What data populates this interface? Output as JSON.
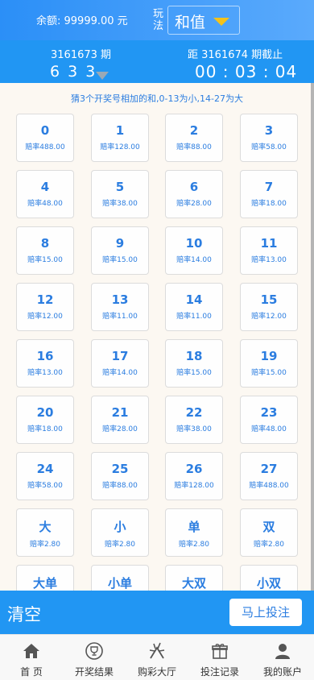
{
  "header": {
    "balance": "余额: 99999.00 元",
    "play_label": "玩法",
    "play_value": "和值"
  },
  "issue": {
    "current": "3161673 期",
    "result": "6 3 3",
    "next": "距 3161674 期截止",
    "countdown": "00 : 03 : 04"
  },
  "rule": "猜3个开奖号相加的和,0-13为小,14-27为大",
  "bets": [
    {
      "label": "0",
      "odds": "赔率488.00"
    },
    {
      "label": "1",
      "odds": "赔率128.00"
    },
    {
      "label": "2",
      "odds": "赔率88.00"
    },
    {
      "label": "3",
      "odds": "赔率58.00"
    },
    {
      "label": "4",
      "odds": "赔率48.00"
    },
    {
      "label": "5",
      "odds": "赔率38.00"
    },
    {
      "label": "6",
      "odds": "赔率28.00"
    },
    {
      "label": "7",
      "odds": "赔率18.00"
    },
    {
      "label": "8",
      "odds": "赔率15.00"
    },
    {
      "label": "9",
      "odds": "赔率15.00"
    },
    {
      "label": "10",
      "odds": "赔率14.00"
    },
    {
      "label": "11",
      "odds": "赔率13.00"
    },
    {
      "label": "12",
      "odds": "赔率12.00"
    },
    {
      "label": "13",
      "odds": "赔率11.00"
    },
    {
      "label": "14",
      "odds": "赔率11.00"
    },
    {
      "label": "15",
      "odds": "赔率12.00"
    },
    {
      "label": "16",
      "odds": "赔率13.00"
    },
    {
      "label": "17",
      "odds": "赔率14.00"
    },
    {
      "label": "18",
      "odds": "赔率15.00"
    },
    {
      "label": "19",
      "odds": "赔率15.00"
    },
    {
      "label": "20",
      "odds": "赔率18.00"
    },
    {
      "label": "21",
      "odds": "赔率28.00"
    },
    {
      "label": "22",
      "odds": "赔率38.00"
    },
    {
      "label": "23",
      "odds": "赔率48.00"
    },
    {
      "label": "24",
      "odds": "赔率58.00"
    },
    {
      "label": "25",
      "odds": "赔率88.00"
    },
    {
      "label": "26",
      "odds": "赔率128.00"
    },
    {
      "label": "27",
      "odds": "赔率488.00"
    },
    {
      "label": "大",
      "odds": "赔率2.80"
    },
    {
      "label": "小",
      "odds": "赔率2.80"
    },
    {
      "label": "单",
      "odds": "赔率2.80"
    },
    {
      "label": "双",
      "odds": "赔率2.80"
    },
    {
      "label": "大单",
      "odds": ""
    },
    {
      "label": "小单",
      "odds": ""
    },
    {
      "label": "大双",
      "odds": ""
    },
    {
      "label": "小双",
      "odds": ""
    }
  ],
  "actions": {
    "clear": "清空",
    "submit": "马上投注"
  },
  "tabs": [
    {
      "label": "首 页",
      "icon": "home-icon"
    },
    {
      "label": "开奖结果",
      "icon": "trophy-icon"
    },
    {
      "label": "购彩大厅",
      "icon": "lottery-hall-icon"
    },
    {
      "label": "投注记录",
      "icon": "gift-icon"
    },
    {
      "label": "我的账户",
      "icon": "user-icon"
    }
  ],
  "colors": {
    "header_blue": "#2196f3",
    "accent_text": "#2b7de0",
    "dropdown_arrow": "#f3c21b",
    "content_bg": "#fcf8f2"
  }
}
